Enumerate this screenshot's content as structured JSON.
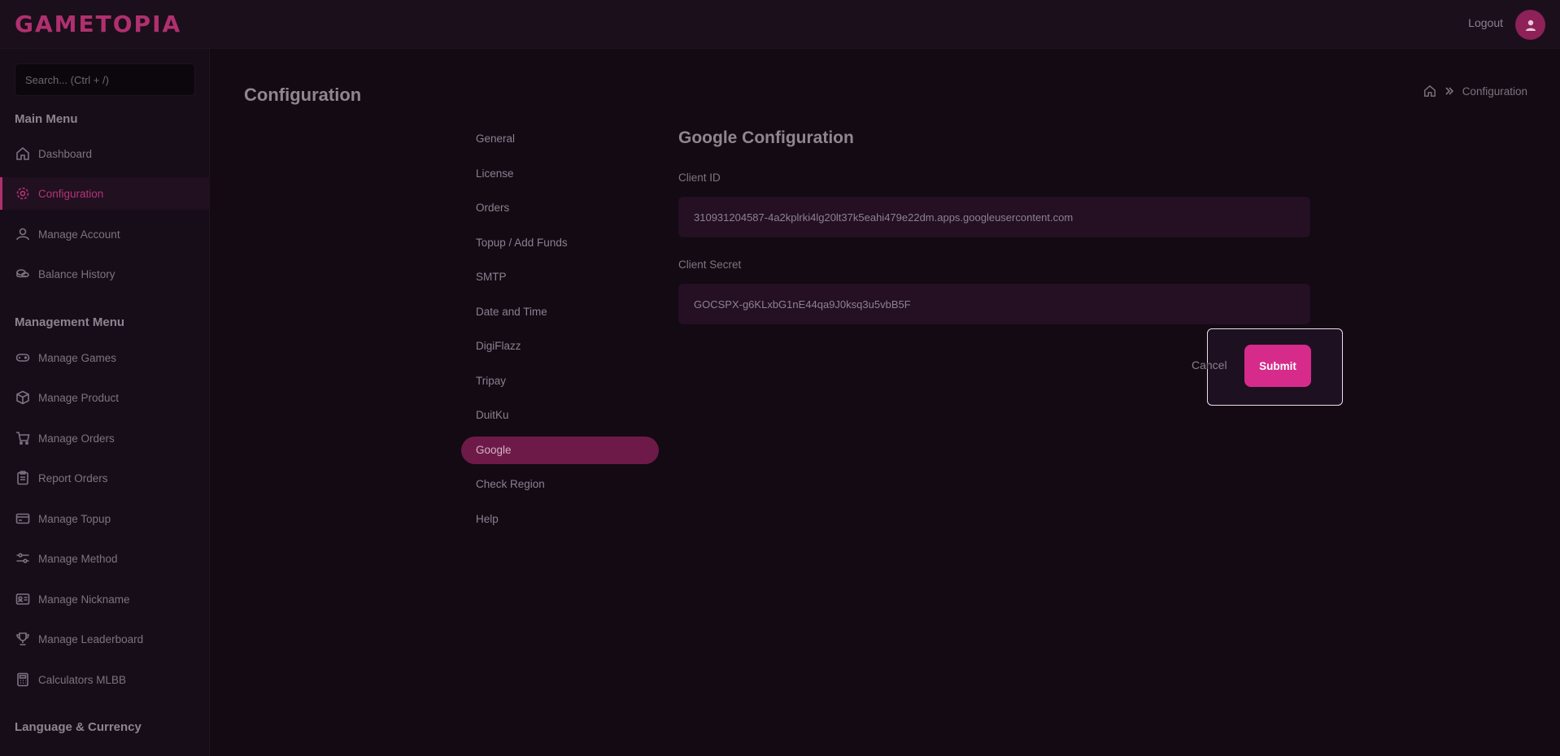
{
  "app": {
    "logo": "GAMETOPIA",
    "logout_label": "Logout"
  },
  "sidebar": {
    "search_placeholder": "Search... (Ctrl + /)",
    "main_heading": "Main Menu",
    "main_items": [
      {
        "label": "Dashboard",
        "icon": "home-icon"
      },
      {
        "label": "Configuration",
        "icon": "gear-icon",
        "active": true
      },
      {
        "label": "Manage Account",
        "icon": "user-icon"
      },
      {
        "label": "Balance History",
        "icon": "coins-icon"
      }
    ],
    "management_heading": "Management Menu",
    "management_items": [
      {
        "label": "Manage Games",
        "icon": "gamepad-icon"
      },
      {
        "label": "Manage Product",
        "icon": "box-icon"
      },
      {
        "label": "Manage Orders",
        "icon": "cart-icon"
      },
      {
        "label": "Report Orders",
        "icon": "clipboard-icon"
      },
      {
        "label": "Manage Topup",
        "icon": "card-icon"
      },
      {
        "label": "Manage Method",
        "icon": "sliders-icon"
      },
      {
        "label": "Manage Nickname",
        "icon": "id-card-icon"
      },
      {
        "label": "Manage Leaderboard",
        "icon": "trophy-icon"
      },
      {
        "label": "Calculators MLBB",
        "icon": "calculator-icon"
      }
    ],
    "language_heading": "Language & Currency"
  },
  "page": {
    "title": "Configuration",
    "breadcrumb_current": "Configuration"
  },
  "subnav": [
    {
      "label": "General"
    },
    {
      "label": "License"
    },
    {
      "label": "Orders"
    },
    {
      "label": "Topup / Add Funds"
    },
    {
      "label": "SMTP"
    },
    {
      "label": "Date and Time"
    },
    {
      "label": "DigiFlazz"
    },
    {
      "label": "Tripay"
    },
    {
      "label": "DuitKu"
    },
    {
      "label": "Google",
      "active": true
    },
    {
      "label": "Check Region"
    },
    {
      "label": "Help"
    }
  ],
  "google_config": {
    "title": "Google Configuration",
    "client_id_label": "Client ID",
    "client_id_value": "310931204587-4a2kplrki4lg20lt37k5eahi479e22dm.apps.googleusercontent.com",
    "client_secret_label": "Client Secret",
    "client_secret_value": "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",
    "cancel_label": "Cancel",
    "submit_label": "Submit"
  },
  "colors": {
    "accent": "#d62b8b",
    "active_tab": "#6e1a48",
    "background": "#130a14"
  }
}
